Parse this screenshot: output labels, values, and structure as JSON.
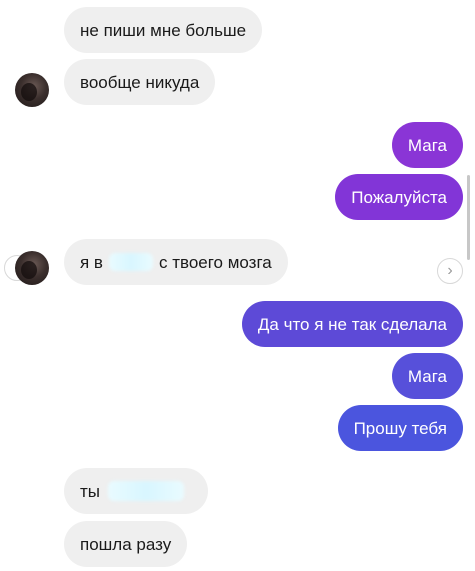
{
  "messages": [
    {
      "side": "in",
      "text": "не пиши мне больше"
    },
    {
      "side": "in",
      "text": "вообще никуда"
    },
    {
      "side": "out",
      "text": "Мага"
    },
    {
      "side": "out",
      "text": "Пожалуйста"
    },
    {
      "side": "in",
      "before": "я в",
      "after": "с твоего мозга"
    },
    {
      "side": "out",
      "text": "Да что я не так сделала"
    },
    {
      "side": "out",
      "text": "Мага"
    },
    {
      "side": "out",
      "text": "Прошу тебя"
    },
    {
      "side": "in",
      "before": "ты",
      "after": ""
    },
    {
      "side": "in",
      "text": "пошла разу"
    }
  ],
  "colors": {
    "incoming_bg": "#efefef",
    "outgoing_purple": "#8a35d6",
    "outgoing_indigo": "#5a4bd8",
    "outgoing_blue": "#4a54dd"
  },
  "icons": {
    "prev": "chevron-left-icon",
    "next": "chevron-right-icon"
  }
}
